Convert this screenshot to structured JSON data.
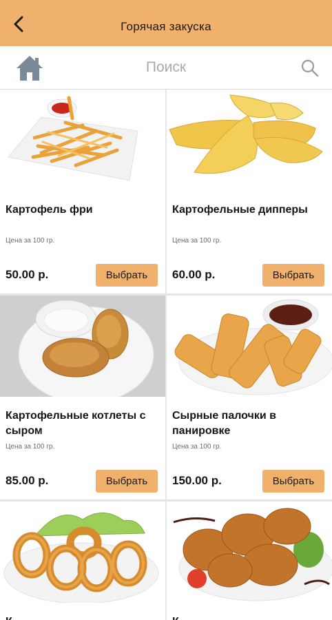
{
  "header": {
    "title": "Горячая закуска",
    "back_icon": "chevron-left-icon"
  },
  "search": {
    "placeholder": "Поиск",
    "home_icon": "home-icon",
    "search_icon": "search-icon"
  },
  "colors": {
    "accent": "#f0b16d",
    "divider": "#e6e6e6"
  },
  "products": [
    {
      "name": "Картофель фри",
      "price_note": "Цена за 100 гр.",
      "price": "50.00 р.",
      "button": "Выбрать"
    },
    {
      "name": "Картофельные дипперы",
      "price_note": "Цена за 100 гр.",
      "price": "60.00 р.",
      "button": "Выбрать"
    },
    {
      "name": "Картофельные котлеты с сыром",
      "price_note": "Цена за 100 гр.",
      "price": "85.00 р.",
      "button": "Выбрать"
    },
    {
      "name": "Сырные палочки в панировке",
      "price_note": "Цена за 100 гр.",
      "price": "150.00 р.",
      "button": "Выбрать"
    },
    {
      "name": "К",
      "price_note": "",
      "price": "",
      "button": ""
    },
    {
      "name": "К",
      "price_note": "",
      "price": "",
      "button": ""
    }
  ]
}
